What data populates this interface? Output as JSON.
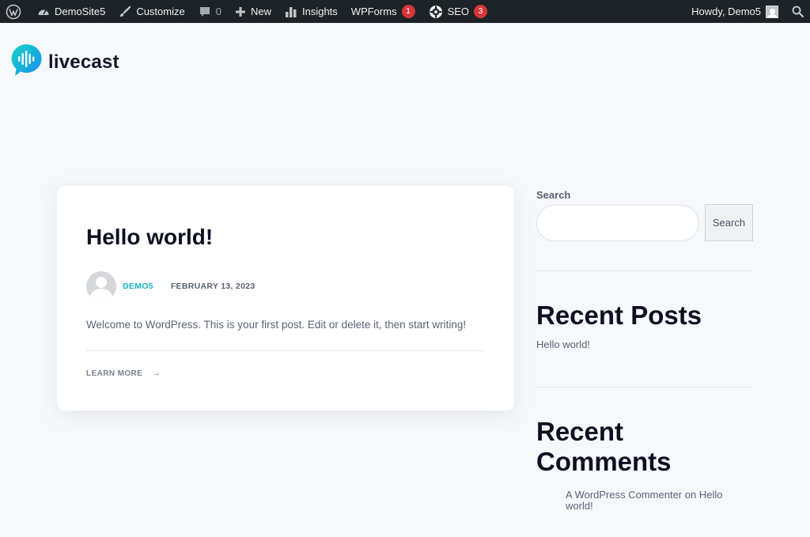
{
  "adminbar": {
    "site": "DemoSite5",
    "customize": "Customize",
    "comments_count": "0",
    "new": "New",
    "insights": "Insights",
    "wpforms": "WPForms",
    "wpforms_count": "1",
    "seo": "SEO",
    "seo_count": "3",
    "howdy": "Howdy, Demo5"
  },
  "logo": {
    "text": "livecast",
    "colors": {
      "gradient_start": "#18d6c2",
      "gradient_end": "#1a8df0"
    }
  },
  "post": {
    "title": "Hello world!",
    "author": "DEMO5",
    "date": "FEBRUARY 13, 2023",
    "excerpt": "Welcome to WordPress. This is your first post. Edit or delete it, then start writing!",
    "learn_more": "LEARN MORE",
    "arrow": "→"
  },
  "sidebar": {
    "search_label": "Search",
    "search_button": "Search",
    "search_value": "",
    "recent_posts_title": "Recent Posts",
    "recent_posts": [
      "Hello world!"
    ],
    "recent_comments_title_line1": "Recent",
    "recent_comments_title_line2": "Comments",
    "recent_comments": [
      {
        "line1": "A WordPress Commenter on Hello",
        "line2": "world!"
      }
    ]
  },
  "colors": {
    "accent": "#17b3c9",
    "adminbar_bg": "#1d2327",
    "badge": "#d63638"
  }
}
